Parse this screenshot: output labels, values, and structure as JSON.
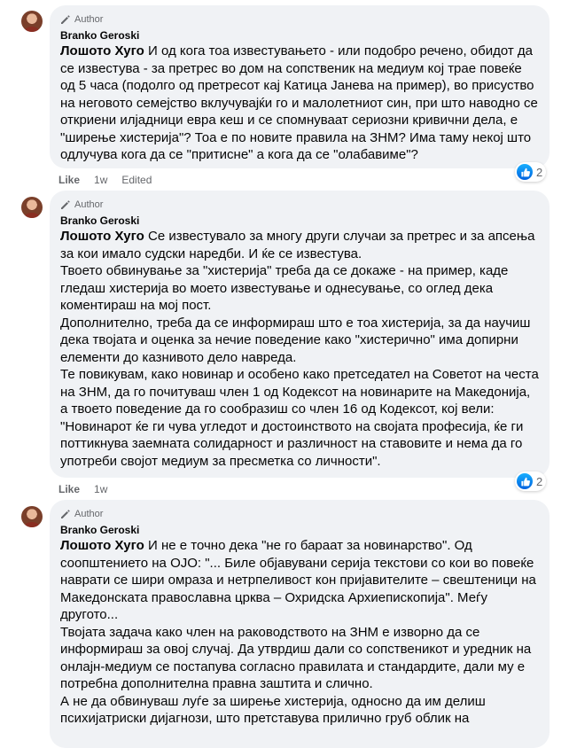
{
  "comments": [
    {
      "badge": "Author",
      "name": "Branko Geroski",
      "mention": "Лошото Хуго",
      "paragraphs": [
        "И од кога тоа известувањето - или подобро речено, обидот да се известува - за претрес во дом на сопственик на медиум кој трае повеќе од 5 часа (подолго од претресот кај Катица Јанева на пример), во присуство на неговото семејство вклучувајќи го и малолетниот син, при што наводно се откриени илјадници евра кеш и се спомнуваат сериозни кривични дела, е \"ширење хистерија\"? Тоа е по новите правила на ЗНМ? Има таму некој што одлучува кога да се \"притисне\" а кога да се \"олабавиме\"?"
      ],
      "like": "Like",
      "time": "1w",
      "edited": "Edited",
      "reaction_count": "2"
    },
    {
      "badge": "Author",
      "name": "Branko Geroski",
      "mention": "Лошото Хуго",
      "paragraphs": [
        "Се известувало за многу други случаи за претрес и за апсења за кои имало судски наредби. И ќе се известува.",
        "Твоето обвинување за \"хистерија\" треба да се докаже - на пример, каде гледаш хистерија во моето известување и однесување, со оглед дека коментираш на мој пост.",
        "Дополнително, треба да се информираш што е тоа хистерија, за да научиш дека твојата и оценка за нечие поведение како \"хистерично\" има допирни елементи до казнивото дело навреда.",
        "Те повикувам, како новинар и особено како претседател на Советот на честа на ЗНМ, да го почитуваш член 1 од Кодексот на новинарите на Македонија, а твоето поведение да го сообразиш со член 16 од Кодексот, кој вели: \"Новинарот ќе ги чува угледот и достоинството на својата професија, ќе ги поттикнува заемната солидарност и различност на ставовите и нема да го употреби својот медиум за пресметка со личности\"."
      ],
      "like": "Like",
      "time": "1w",
      "reaction_count": "2"
    },
    {
      "badge": "Author",
      "name": "Branko Geroski",
      "mention": "Лошото Хуго",
      "paragraphs": [
        "И не е точно дека \"не го бараат за новинарство\". Од соопштението на ОЈО: \"... Биле објавувани серија текстови со кои во повеќе наврати се шири омраза и нетрпеливост кон пријавителите – свештеници на Македонската православна црква – Охридска Архиепископија\". Меѓу другото...",
        "Твојата задача како член на раководството на ЗНМ е изворно да се информираш за овој случај. Да утврдиш дали со сопственикот и уредник на онлајн-медиум се постапува согласно правилата и стандардите, дали му е потребна дополнителна правна заштита и слично.",
        "А не да обвинуваш луѓе за ширење хистерија, односно да им делиш психијатриски дијагнози, што претставува прилично груб облик на"
      ]
    }
  ],
  "colors": {
    "bubble": "#f0f2f5",
    "meta_text": "#65676b",
    "like_blue": "#0866ff"
  },
  "icons": [
    "avatar",
    "pencil-author-icon",
    "like-reaction-icon"
  ]
}
